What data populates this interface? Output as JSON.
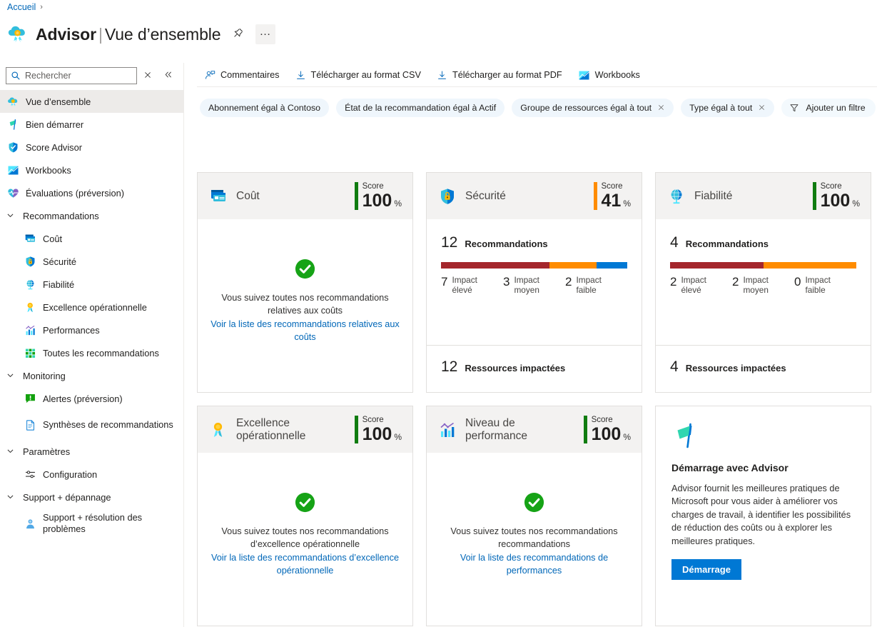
{
  "breadcrumb": {
    "home": "Accueil",
    "separator": "›"
  },
  "header": {
    "title": "Advisor",
    "divider": "|",
    "subtitle": "Vue d’ensemble",
    "pin_label": "Épingler",
    "more_label": "…"
  },
  "search": {
    "placeholder": "Rechercher",
    "value": ""
  },
  "sidebar": {
    "items": [
      {
        "label": "Vue d’ensemble",
        "icon": "advisor-cloud-icon",
        "level": "top",
        "selected": true
      },
      {
        "label": "Bien démarrer",
        "icon": "flag-icon",
        "level": "top",
        "selected": false
      },
      {
        "label": "Score Advisor",
        "icon": "shield-icon",
        "level": "top",
        "selected": false
      },
      {
        "label": "Workbooks",
        "icon": "workbook-icon",
        "level": "top",
        "selected": false
      },
      {
        "label": "Évaluations (préversion)",
        "icon": "heart-pulse-icon",
        "level": "top",
        "selected": false
      },
      {
        "label": "Recommandations",
        "icon": "chevron-down-icon",
        "level": "group",
        "selected": false
      },
      {
        "label": "Coût",
        "icon": "cost-card-icon",
        "level": "child",
        "selected": false
      },
      {
        "label": "Sécurité",
        "icon": "security-shield-icon",
        "level": "child",
        "selected": false
      },
      {
        "label": "Fiabilité",
        "icon": "reliability-globe-icon",
        "level": "child",
        "selected": false
      },
      {
        "label": "Excellence opérationnelle",
        "icon": "ribbon-icon",
        "level": "child",
        "selected": false
      },
      {
        "label": "Performances",
        "icon": "performance-chart-icon",
        "level": "child",
        "selected": false
      },
      {
        "label": "Toutes les recommandations",
        "icon": "grid-icon",
        "level": "child",
        "selected": false
      },
      {
        "label": "Monitoring",
        "icon": "chevron-down-icon",
        "level": "group",
        "selected": false
      },
      {
        "label": "Alertes (préversion)",
        "icon": "alert-icon",
        "level": "child",
        "selected": false
      },
      {
        "label": "Synthèses de recommandations",
        "icon": "document-icon",
        "level": "child",
        "selected": false
      },
      {
        "label": "Paramètres",
        "icon": "chevron-down-icon",
        "level": "group",
        "selected": false
      },
      {
        "label": "Configuration",
        "icon": "sliders-icon",
        "level": "child",
        "selected": false
      },
      {
        "label": "Support + dépannage",
        "icon": "chevron-down-icon",
        "level": "group",
        "selected": false
      },
      {
        "label": "Support + résolution des problèmes",
        "icon": "person-support-icon",
        "level": "child",
        "selected": false
      }
    ]
  },
  "commandbar": {
    "items": [
      {
        "label": "Commentaires",
        "icon": "feedback-person-icon"
      },
      {
        "label": "Télécharger au format CSV",
        "icon": "download-icon"
      },
      {
        "label": "Télécharger au format PDF",
        "icon": "download-icon"
      },
      {
        "label": "Workbooks",
        "icon": "workbook-icon"
      }
    ]
  },
  "filters": {
    "chips": [
      {
        "label": "Abonnement égal à Contoso",
        "removable": false
      },
      {
        "label": "État de la recommandation égal à Actif",
        "removable": false
      },
      {
        "label": "Groupe de ressources égal à tout",
        "removable": true
      },
      {
        "label": "Type égal à tout",
        "removable": true
      }
    ],
    "add_filter": "Ajouter un filtre"
  },
  "score_word": "Score",
  "percent_symbol": "%",
  "colors": {
    "green": "#107c10",
    "orange": "#ff8c00",
    "high_impact": "#a4262c",
    "medium_impact": "#ff8c00",
    "low_impact": "#0078d4",
    "link": "#0067b8",
    "primary_button": "#0078d4"
  },
  "cards": {
    "cost": {
      "name": "Coût",
      "icon": "cost-card-icon",
      "score": "100",
      "score_color": "#107c10",
      "state": "healthy",
      "message": "Vous suivez toutes nos recommandations relatives aux coûts",
      "link": "Voir la liste des recommandations relatives aux coûts"
    },
    "security": {
      "name": "Sécurité",
      "icon": "security-shield-icon",
      "score": "41",
      "score_color": "#ff8c00",
      "state": "recommendations",
      "recommendations_count": "12",
      "recommendations_label": "Recommandations",
      "impacts": [
        {
          "count": "7",
          "label_line1": "Impact",
          "label_line2": "élevé",
          "color": "#a4262c"
        },
        {
          "count": "3",
          "label_line1": "Impact",
          "label_line2": "moyen",
          "color": "#ff8c00"
        },
        {
          "count": "2",
          "label_line1": "Impact",
          "label_line2": "faible",
          "color": "#0078d4"
        }
      ],
      "resources_count": "12",
      "resources_label": "Ressources impactées"
    },
    "reliability": {
      "name": "Fiabilité",
      "icon": "reliability-globe-icon",
      "score": "100",
      "score_color": "#107c10",
      "state": "recommendations",
      "recommendations_count": "4",
      "recommendations_label": "Recommandations",
      "impacts": [
        {
          "count": "2",
          "label_line1": "Impact",
          "label_line2": "élevé",
          "color": "#a4262c"
        },
        {
          "count": "2",
          "label_line1": "Impact",
          "label_line2": "moyen",
          "color": "#ff8c00"
        },
        {
          "count": "0",
          "label_line1": "Impact",
          "label_line2": "faible",
          "color": "#0078d4"
        }
      ],
      "resources_count": "4",
      "resources_label": "Ressources impactées"
    },
    "operational": {
      "name": "Excellence opérationnelle",
      "icon": "ribbon-icon",
      "score": "100",
      "score_color": "#107c10",
      "state": "healthy",
      "message": "Vous suivez toutes nos recommandations d’excellence opérationnelle",
      "link": "Voir la liste des recommandations d’excellence opérationnelle"
    },
    "performance": {
      "name": "Niveau de performance",
      "icon": "performance-chart-icon",
      "score": "100",
      "score_color": "#107c10",
      "state": "healthy",
      "message": "Vous suivez toutes nos recommandations recommandations",
      "link": "Voir la liste des recommandations de performances"
    },
    "getting_started": {
      "icon": "flag-icon",
      "title": "Démarrage avec Advisor",
      "description": "Advisor fournit les meilleures pratiques de Microsoft pour vous aider à améliorer vos charges de travail, à identifier les possibilités de réduction des coûts ou à explorer les meilleures pratiques.",
      "button": "Démarrage"
    }
  },
  "chart_data": [
    {
      "type": "bar",
      "title": "Sécurité — Recommandations par impact",
      "categories": [
        "Impact élevé",
        "Impact moyen",
        "Impact faible"
      ],
      "values": [
        7,
        3,
        2
      ],
      "total": 12,
      "colors": [
        "#a4262c",
        "#ff8c00",
        "#0078d4"
      ],
      "orientation": "horizontal-stacked",
      "grid": false,
      "legend": "inline-below"
    },
    {
      "type": "bar",
      "title": "Fiabilité — Recommandations par impact",
      "categories": [
        "Impact élevé",
        "Impact moyen",
        "Impact faible"
      ],
      "values": [
        2,
        2,
        0
      ],
      "total": 4,
      "colors": [
        "#a4262c",
        "#ff8c00",
        "#0078d4"
      ],
      "orientation": "horizontal-stacked",
      "grid": false,
      "legend": "inline-below"
    }
  ]
}
